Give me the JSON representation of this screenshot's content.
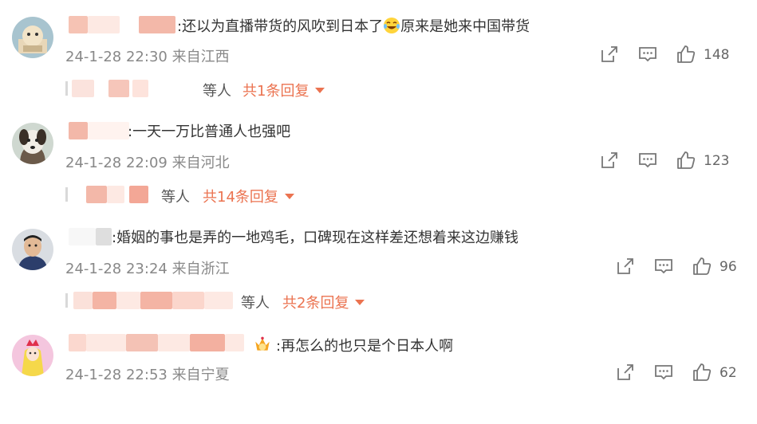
{
  "comments": [
    {
      "text_before_emoji": ":还以为直播带货的风吹到日本了",
      "emoji": "laugh-cry-emoji",
      "text_after_emoji": "原来是她来中国带货",
      "meta": "24-1-28 22:30 来自江西",
      "likes": "148",
      "reply_suffix": "等人",
      "reply_count_label": "共1条回复"
    },
    {
      "text": ":一天一万比普通人也强吧",
      "meta": "24-1-28 22:09 来自河北",
      "likes": "123",
      "reply_suffix": "等人",
      "reply_count_label": "共14条回复"
    },
    {
      "text": ":婚姻的事也是弄的一地鸡毛，口碑现在这样差还想着来这边赚钱",
      "meta": "24-1-28 23:24 来自浙江",
      "likes": "96",
      "reply_suffix": "等人",
      "reply_count_label": "共2条回复"
    },
    {
      "emoji_before_text": "crown-badge-emoji",
      "text": ":再怎么的也只是个日本人啊",
      "meta": "24-1-28 22:53 来自宁夏",
      "likes": "62"
    }
  ],
  "colors": {
    "accent": "#eb7350",
    "meta": "#888888",
    "blur": "#f3b8a9"
  }
}
